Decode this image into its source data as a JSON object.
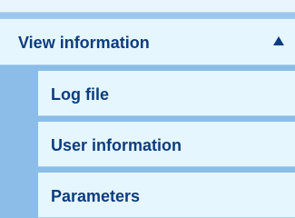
{
  "menu": {
    "section": {
      "label": "View information",
      "icon": "triangle-up-icon"
    },
    "items": [
      {
        "label": "Log file"
      },
      {
        "label": "User information"
      },
      {
        "label": "Parameters"
      }
    ]
  },
  "colors": {
    "background": "#9cc6ee",
    "item_background": "#e6f6ff",
    "text": "#0b3d7e"
  }
}
